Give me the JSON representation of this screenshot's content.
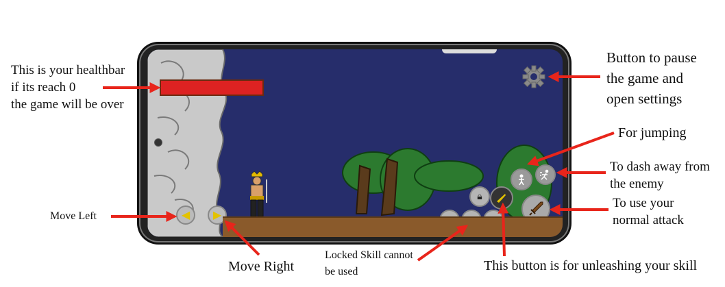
{
  "annotations": {
    "healthbar": [
      "This is your healthbar",
      "if its reach 0",
      "the game will be over"
    ],
    "pause": [
      "Button to pause",
      "the game and",
      "open settings"
    ],
    "jump": "For jumping",
    "dash": [
      "To dash away from",
      "the enemy"
    ],
    "attack": [
      "To use your",
      "normal attack"
    ],
    "move_left": "Move Left",
    "move_right": "Move Right",
    "locked": [
      "Locked Skill cannot",
      "be used"
    ],
    "skill": "This button is for unleashing your skill"
  },
  "icons": {
    "settings": "gear-icon",
    "jump": "jump-figure-icon",
    "dash": "dash-figure-icon",
    "attack": "sword-icon",
    "skill": "skill-blade-icon",
    "locked": "lock-icon",
    "left": "triangle-left-icon",
    "right": "triangle-right-icon"
  },
  "colors": {
    "sky": "#262d6b",
    "ground": "#8a5a2b",
    "health": "#dd2222",
    "arrow": "#e8251b",
    "dpad": "#e3c200"
  }
}
